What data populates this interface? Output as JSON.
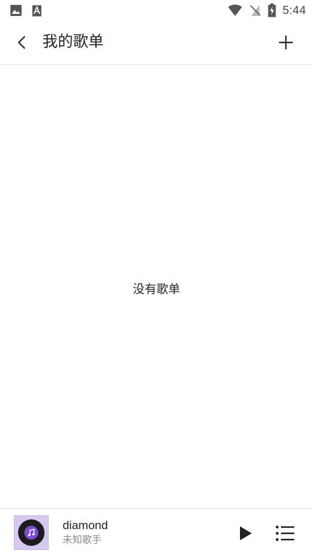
{
  "status_bar": {
    "time": "5:44",
    "left_icons": [
      "image-icon",
      "a-notification-icon"
    ],
    "right_icons": [
      "wifi-icon",
      "no-sim-icon",
      "battery-charging-icon"
    ]
  },
  "header": {
    "title": "我的歌单",
    "back_icon": "chevron-left-icon",
    "add_icon": "plus-icon"
  },
  "main": {
    "empty_message": "没有歌单"
  },
  "player": {
    "track_title": "diamond",
    "artist": "未知歌手",
    "album_art_color": "#d6c8ef",
    "disc_center_color": "#7d4ad3",
    "play_icon": "play-icon",
    "queue_icon": "playlist-icon"
  }
}
